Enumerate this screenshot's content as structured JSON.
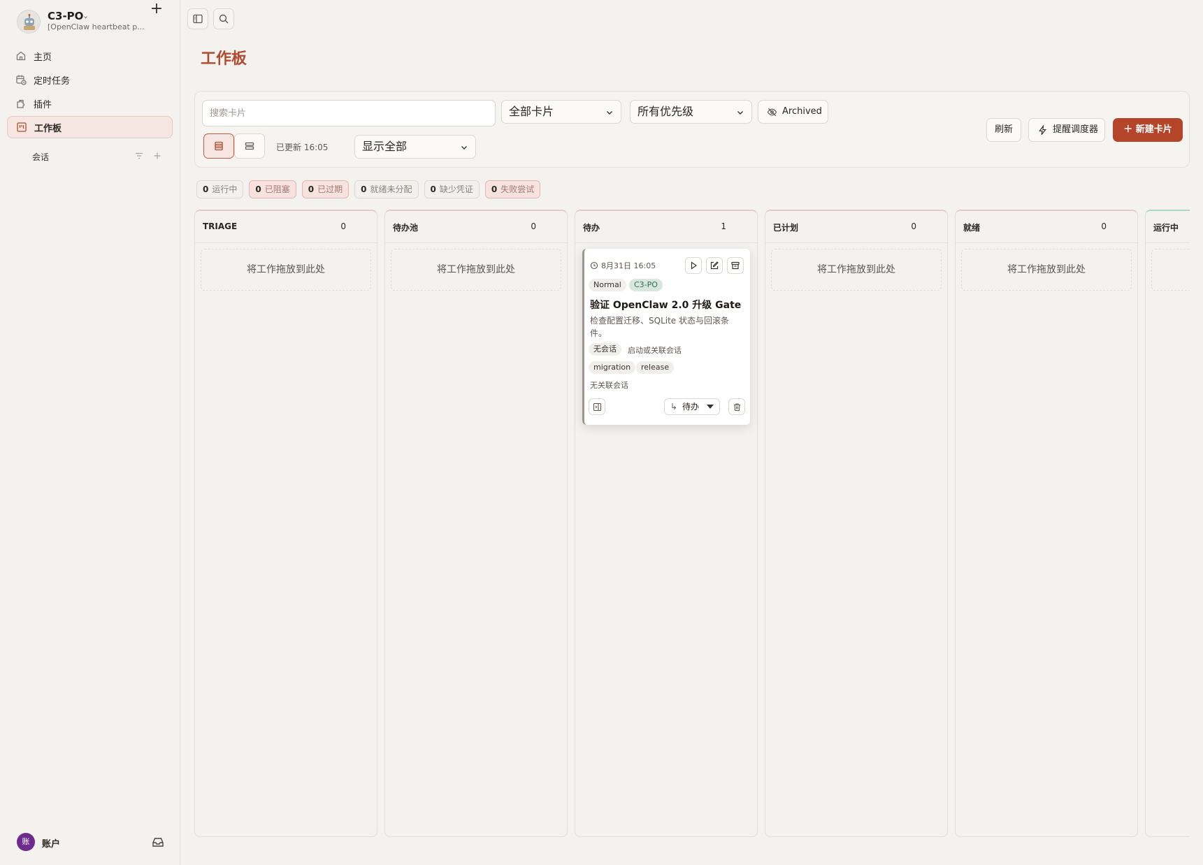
{
  "sidebar": {
    "agent_name": "C3-PO",
    "agent_subtitle": "[OpenClaw heartbeat p...",
    "nav": [
      {
        "label": "主页",
        "icon": "home-icon"
      },
      {
        "label": "定时任务",
        "icon": "calendar-clock-icon"
      },
      {
        "label": "插件",
        "icon": "puzzle-icon"
      },
      {
        "label": "工作板",
        "icon": "kanban-icon",
        "active": true
      }
    ],
    "sessions_label": "会话",
    "account_avatar": "账",
    "account_label": "账户"
  },
  "page": {
    "title": "工作板"
  },
  "toolbar": {
    "search_placeholder": "搜索卡片",
    "card_filter": "全部卡片",
    "priority_filter": "所有优先级",
    "archived_label": "Archived",
    "updated": "已更新 16:05",
    "display_filter": "显示全部",
    "refresh_label": "刷新",
    "scheduler_label": "提醒调度器",
    "new_card_label": "＋ 新建卡片"
  },
  "stats": [
    {
      "count": "0",
      "label": "运行中",
      "warn": false
    },
    {
      "count": "0",
      "label": "已阻塞",
      "warn": true
    },
    {
      "count": "0",
      "label": "已过期",
      "warn": true
    },
    {
      "count": "0",
      "label": "就绪未分配",
      "warn": false
    },
    {
      "count": "0",
      "label": "缺少凭证",
      "warn": false
    },
    {
      "count": "0",
      "label": "失败尝试",
      "warn": true
    }
  ],
  "columns": [
    {
      "title": "TRIAGE",
      "count": "0"
    },
    {
      "title": "待办池",
      "count": "0"
    },
    {
      "title": "待办",
      "count": "1"
    },
    {
      "title": "已计划",
      "count": "0"
    },
    {
      "title": "就绪",
      "count": "0"
    },
    {
      "title": "运行中",
      "count": ""
    }
  ],
  "drop_hint": "将工作拖放到此处",
  "card": {
    "time": "8月31日 16:05",
    "priority": "Normal",
    "agent": "C3-PO",
    "title": "验证 OpenClaw 2.0 升级 Gate",
    "description": "检查配置迁移、SQLite 状态与回滚条件。",
    "session_tag": "无会话",
    "session_action": "启动或关联会话",
    "labels": [
      "migration",
      "release"
    ],
    "linked": "无关联会话",
    "status": "待办"
  },
  "colors": {
    "accent": "#b4452a",
    "title": "#b24a2e"
  }
}
